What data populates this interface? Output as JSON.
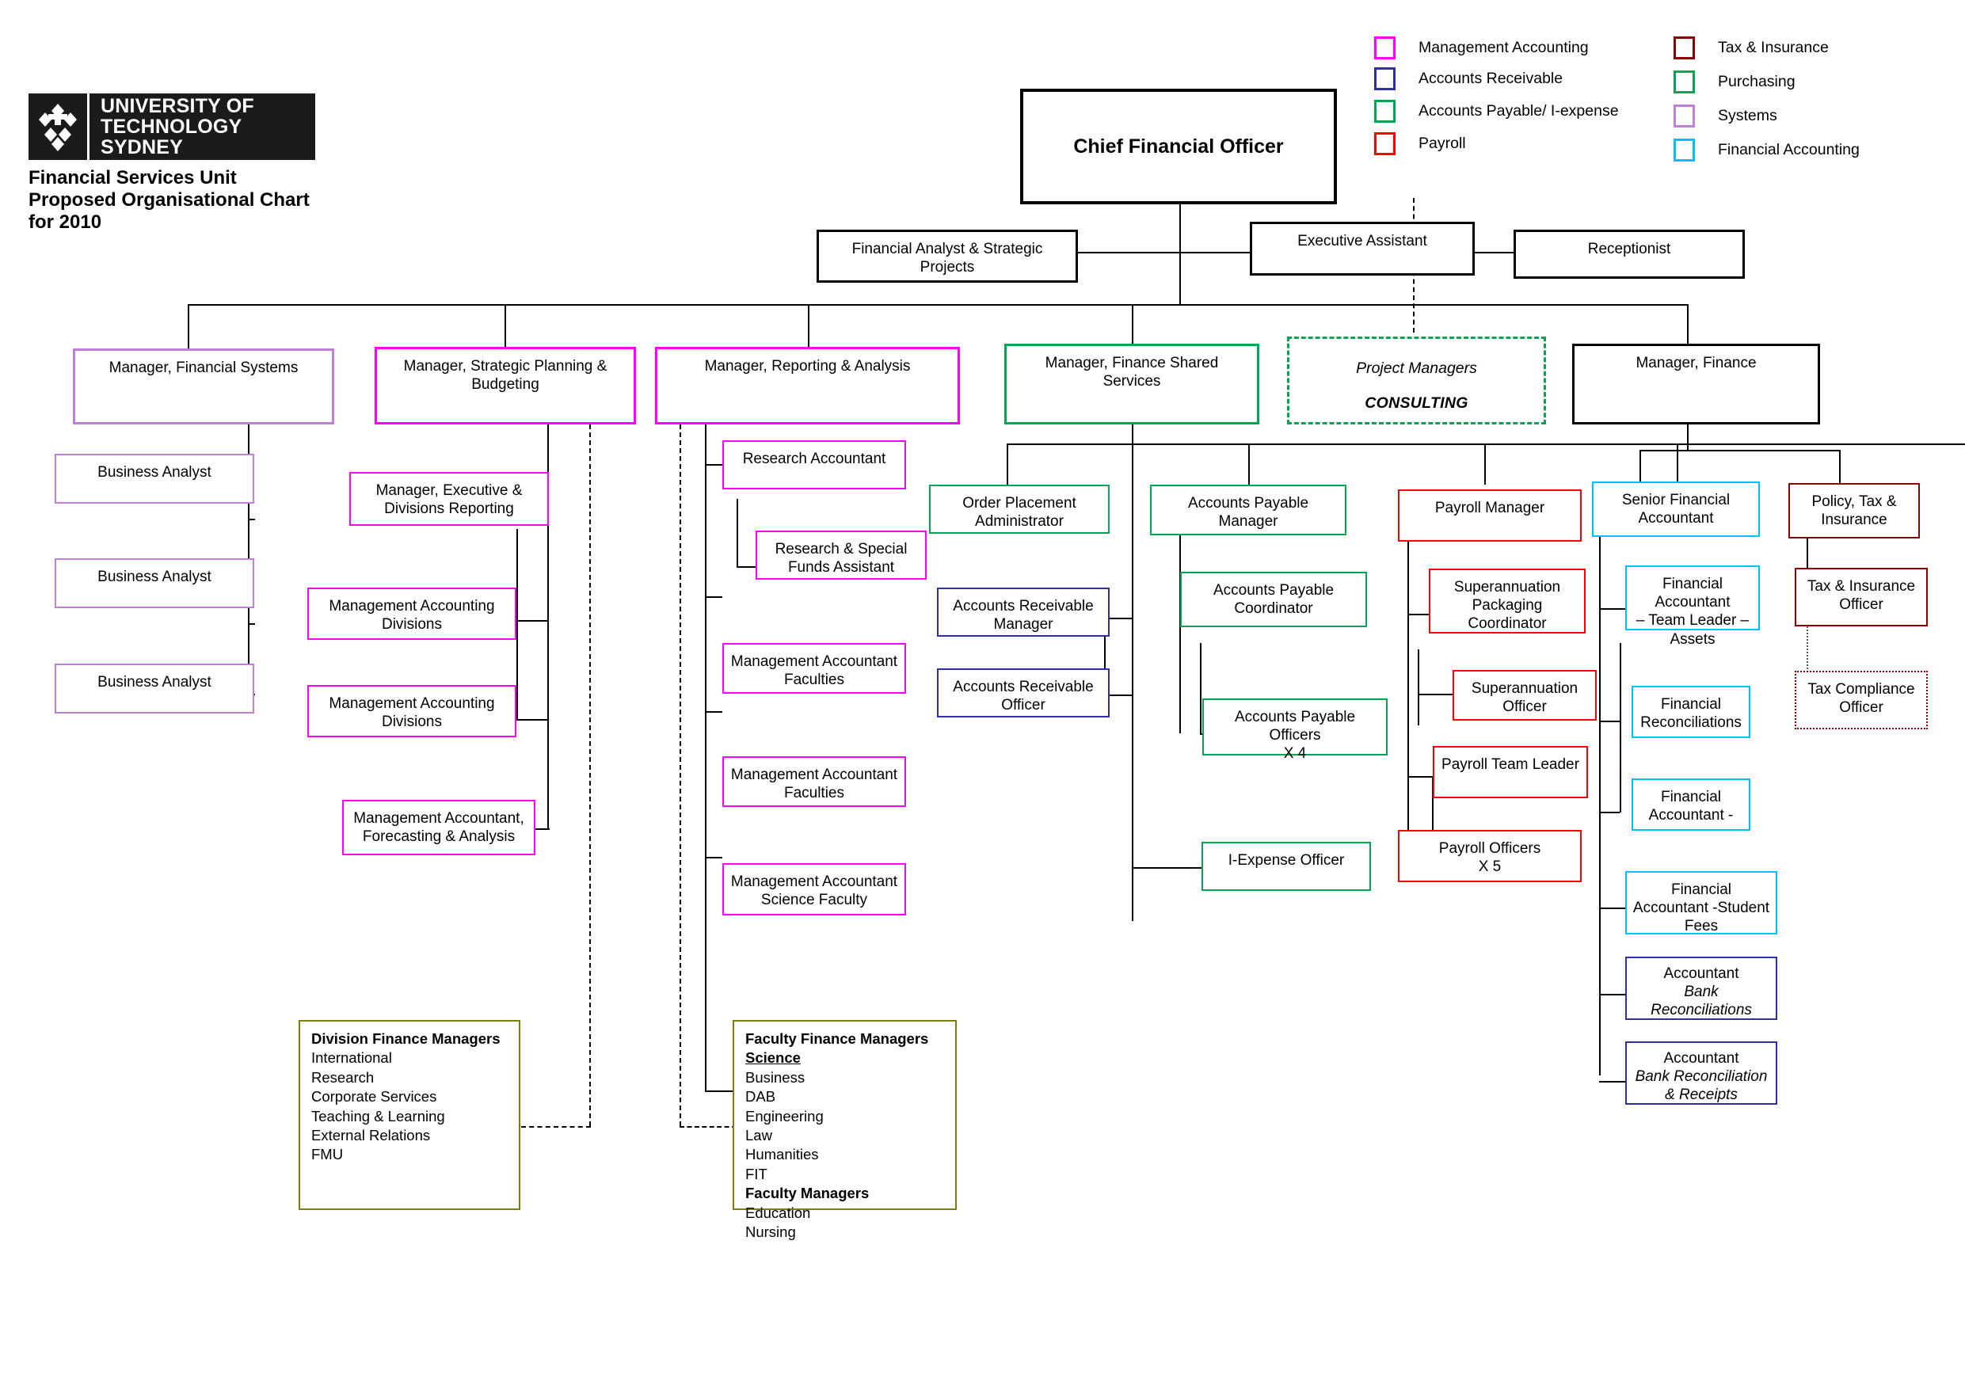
{
  "brand": {
    "logo_line1": "UNIVERSITY OF",
    "logo_line2": "TECHNOLOGY SYDNEY",
    "logo_icon": "uts-diamond-logo"
  },
  "title": {
    "line1": "Financial Services Unit",
    "line2": "Proposed Organisational Chart",
    "line3": "for 2010"
  },
  "colors": {
    "management_accounting": "#ff00ff",
    "accounts_receivable": "#2f2f9f",
    "accounts_payable_iexpense": "#00a651",
    "payroll": "#ff0000",
    "tax_insurance": "#8b0000",
    "purchasing": "#00a651",
    "systems": "#c080d8",
    "financial_accounting": "#00bfff",
    "black": "#000000",
    "olive": "#808000"
  },
  "legend": {
    "left": [
      {
        "label": "Management Accounting",
        "color": "#ff00ff",
        "icon": "legend-swatch"
      },
      {
        "label": "Accounts Receivable",
        "color": "#2f2f9f",
        "icon": "legend-swatch"
      },
      {
        "label": "Accounts Payable/ I-expense",
        "color": "#00a651",
        "icon": "legend-swatch"
      },
      {
        "label": "Payroll",
        "color": "#ff0000",
        "icon": "legend-swatch"
      }
    ],
    "right": [
      {
        "label": "Tax & Insurance",
        "color": "#8b0000",
        "icon": "legend-swatch"
      },
      {
        "label": "Purchasing",
        "color": "#00a651",
        "icon": "legend-swatch"
      },
      {
        "label": "Systems",
        "color": "#c080d8",
        "icon": "legend-swatch"
      },
      {
        "label": "Financial Accounting",
        "color": "#00bfff",
        "icon": "legend-swatch"
      }
    ]
  },
  "chart_data": {
    "type": "diagram",
    "title": "Financial Services Unit Proposed Organisational Chart for 2010",
    "nodes": {
      "cfo": "Chief Financial Officer",
      "financial_analyst": "Financial Analyst & Strategic Projects",
      "executive_assistant": "Executive Assistant",
      "receptionist": "Receptionist",
      "mgr_financial_systems": "Manager, Financial Systems",
      "mgr_strategic_planning": "Manager, Strategic Planning & Budgeting",
      "mgr_reporting_analysis": "Manager, Reporting & Analysis",
      "mgr_finance_shared": "Manager, Finance Shared Services",
      "project_managers_l1": "Project Managers",
      "project_managers_l2": "CONSULTING",
      "mgr_finance": "Manager, Finance",
      "business_analyst_1": "Business Analyst",
      "business_analyst_2": "Business Analyst",
      "business_analyst_3": "Business Analyst",
      "mgr_exec_divisions_reporting": "Manager, Executive & Divisions Reporting",
      "mgmt_acct_divisions_1": "Management Accounting Divisions",
      "mgmt_acct_divisions_2": "Management Accounting Divisions",
      "mgmt_accountant_forecasting": "Management Accountant, Forecasting & Analysis",
      "research_accountant": "Research Accountant",
      "research_special_funds": "Research & Special Funds Assistant",
      "mgmt_accountant_faculties_1": "Management Accountant Faculties",
      "mgmt_accountant_faculties_2": "Management Accountant Faculties",
      "mgmt_accountant_science": "Management Accountant Science Faculty",
      "order_placement_admin": "Order Placement Administrator",
      "ar_manager": "Accounts Receivable Manager",
      "ar_officer": "Accounts Receivable Officer",
      "ap_manager": "Accounts Payable Manager",
      "ap_coordinator": "Accounts Payable Coordinator",
      "ap_officers": "Accounts Payable Officers X 4",
      "iexpense_officer": "I-Expense Officer",
      "payroll_manager": "Payroll Manager",
      "super_packaging_coord": "Superannuation Packaging Coordinator",
      "super_officer": "Superannuation Officer",
      "payroll_team_leader": "Payroll Team Leader",
      "payroll_officers": "Payroll Officers X 5",
      "senior_financial_accountant": "Senior Financial Accountant",
      "fa_team_leader_assets": "Financial Accountant – Team Leader – Assets",
      "financial_reconciliations": "Financial Reconciliations",
      "financial_accountant_dash": "Financial Accountant -",
      "fa_student_fees": "Financial Accountant -Student Fees",
      "accountant_bank_recs": "Accountant Bank Reconciliations",
      "accountant_bank_rec_receipts": "Accountant Bank Reconciliation & Receipts",
      "policy_tax_insurance": "Policy, Tax & Insurance",
      "tax_insurance_officer": "Tax & Insurance Officer",
      "tax_compliance_officer": "Tax Compliance Officer",
      "division_finance_managers": "Division Finance Managers",
      "faculty_finance_managers": "Faculty Finance Managers"
    }
  },
  "boxes": {
    "cfo": {
      "label": "Chief Financial Officer"
    },
    "financial_analyst": {
      "label": "Financial Analyst & Strategic\nProjects"
    },
    "executive_assistant": {
      "label": "Executive Assistant"
    },
    "receptionist": {
      "label": "Receptionist"
    },
    "mgr_financial_systems": {
      "label": "Manager, Financial Systems"
    },
    "mgr_strategic_planning": {
      "label": "Manager, Strategic Planning &\nBudgeting"
    },
    "mgr_reporting_analysis": {
      "label": "Manager, Reporting & Analysis"
    },
    "mgr_finance_shared": {
      "label": "Manager, Finance Shared\nServices"
    },
    "project_managers": {
      "line1": "Project Managers",
      "line2": "CONSULTING"
    },
    "mgr_finance": {
      "label": "Manager, Finance"
    },
    "business_analyst_1": {
      "label": "Business Analyst"
    },
    "business_analyst_2": {
      "label": "Business Analyst"
    },
    "business_analyst_3": {
      "label": "Business Analyst"
    },
    "mgr_exec_divisions_reporting": {
      "label": "Manager, Executive &\nDivisions Reporting"
    },
    "mgmt_acct_divisions_1": {
      "label": "Management Accounting\nDivisions"
    },
    "mgmt_acct_divisions_2": {
      "label": "Management Accounting\nDivisions"
    },
    "mgmt_accountant_forecasting": {
      "label": "Management Accountant,\nForecasting & Analysis"
    },
    "research_accountant": {
      "label": "Research Accountant"
    },
    "research_special_funds": {
      "label": "Research & Special\nFunds Assistant"
    },
    "mgmt_accountant_faculties_1": {
      "label": "Management Accountant\nFaculties"
    },
    "mgmt_accountant_faculties_2": {
      "label": "Management Accountant\nFaculties"
    },
    "mgmt_accountant_science": {
      "label": "Management Accountant\nScience Faculty"
    },
    "order_placement_admin": {
      "label": "Order Placement\nAdministrator"
    },
    "ar_manager": {
      "label": "Accounts Receivable\nManager"
    },
    "ar_officer": {
      "label": "Accounts Receivable\nOfficer"
    },
    "ap_manager": {
      "label": "Accounts Payable Manager"
    },
    "ap_coordinator": {
      "label": "Accounts Payable\nCoordinator"
    },
    "ap_officers": {
      "label": "Accounts Payable Officers\nX 4"
    },
    "iexpense_officer": {
      "label": "I-Expense Officer"
    },
    "payroll_manager": {
      "label": "Payroll Manager"
    },
    "super_packaging_coord": {
      "label": "Superannuation\nPackaging\nCoordinator"
    },
    "super_officer": {
      "label": "Superannuation\nOfficer"
    },
    "payroll_team_leader": {
      "label": "Payroll Team Leader"
    },
    "payroll_officers": {
      "label": "Payroll Officers\nX 5"
    },
    "senior_financial_accountant": {
      "label": "Senior Financial\nAccountant"
    },
    "fa_team_leader_assets": {
      "label": "Financial Accountant\n– Team Leader –\nAssets"
    },
    "financial_reconciliations": {
      "label": "Financial\nReconciliations"
    },
    "financial_accountant_dash": {
      "label": "Financial\nAccountant -"
    },
    "fa_student_fees": {
      "label": "Financial\nAccountant -Student\nFees"
    },
    "accountant_bank_recs": {
      "line1": "Accountant",
      "line2": "Bank\nReconciliations"
    },
    "accountant_bank_rec_receipts": {
      "line1": "Accountant",
      "line2": "Bank Reconciliation\n& Receipts"
    },
    "policy_tax_insurance": {
      "label": "Policy, Tax &\nInsurance"
    },
    "tax_insurance_officer": {
      "label": "Tax & Insurance\nOfficer"
    },
    "tax_compliance_officer": {
      "label": "Tax Compliance\nOfficer"
    },
    "division_finance_managers": {
      "header": "Division Finance Managers",
      "items": [
        "International",
        "Research",
        "Corporate Services",
        "Teaching & Learning",
        "External Relations",
        "FMU"
      ]
    },
    "faculty_finance_managers": {
      "header": "Faculty Finance Managers",
      "header_underlined": "Science",
      "items": [
        "Business",
        "DAB",
        "Engineering",
        "Law",
        "Humanities",
        "FIT"
      ],
      "subheader": "Faculty Managers",
      "subitems": [
        "Education",
        "Nursing"
      ]
    }
  }
}
